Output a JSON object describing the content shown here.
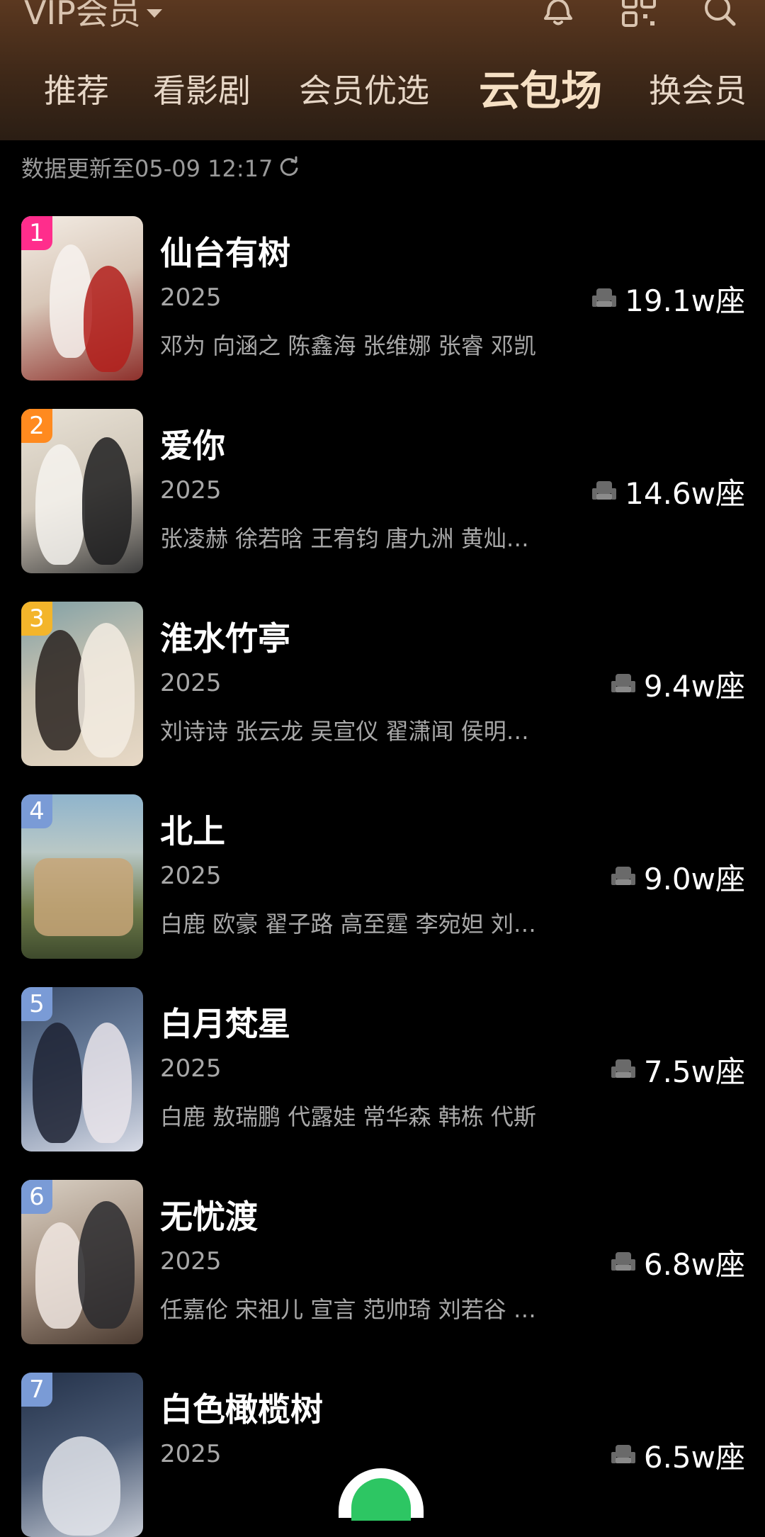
{
  "header": {
    "title": "VIP会员",
    "tabs": [
      {
        "label": "推荐"
      },
      {
        "label": "看影剧"
      },
      {
        "label": "会员优选"
      },
      {
        "label": "云包场"
      },
      {
        "label": "换会员"
      }
    ],
    "active_tab": "云包场"
  },
  "update_text": "数据更新至05-09 12:17",
  "items": [
    {
      "rank": "1",
      "title": "仙台有树",
      "year": "2025",
      "cast": "邓为 向涵之 陈鑫海 张维娜 张睿 邓凯",
      "seats": "19.1w座"
    },
    {
      "rank": "2",
      "title": "爱你",
      "year": "2025",
      "cast": "张凌赫 徐若晗 王宥钧 唐九洲 黄灿…",
      "seats": "14.6w座"
    },
    {
      "rank": "3",
      "title": "淮水竹亭",
      "year": "2025",
      "cast": "刘诗诗 张云龙 吴宣仪 翟潇闻 侯明…",
      "seats": "9.4w座"
    },
    {
      "rank": "4",
      "title": "北上",
      "year": "2025",
      "cast": "白鹿 欧豪 翟子路 高至霆 李宛妲 刘…",
      "seats": "9.0w座"
    },
    {
      "rank": "5",
      "title": "白月梵星",
      "year": "2025",
      "cast": "白鹿 敖瑞鹏 代露娃 常华森 韩栋 代斯",
      "seats": "7.5w座"
    },
    {
      "rank": "6",
      "title": "无忧渡",
      "year": "2025",
      "cast": "任嘉伦 宋祖儿 宣言 范帅琦 刘若谷 …",
      "seats": "6.8w座"
    },
    {
      "rank": "7",
      "title": "白色橄榄树",
      "year": "2025",
      "cast": "",
      "seats": "6.5w座"
    }
  ],
  "colors": {
    "rank1": "#ff2d8c",
    "rank2": "#ff8a1f",
    "rank3": "#f3b52b",
    "rank_other": "#7a9bd6"
  },
  "icons": {
    "header": [
      "bell-icon",
      "qr-scan-icon",
      "search-icon"
    ],
    "seat": "seat-icon",
    "refresh": "refresh-icon"
  }
}
